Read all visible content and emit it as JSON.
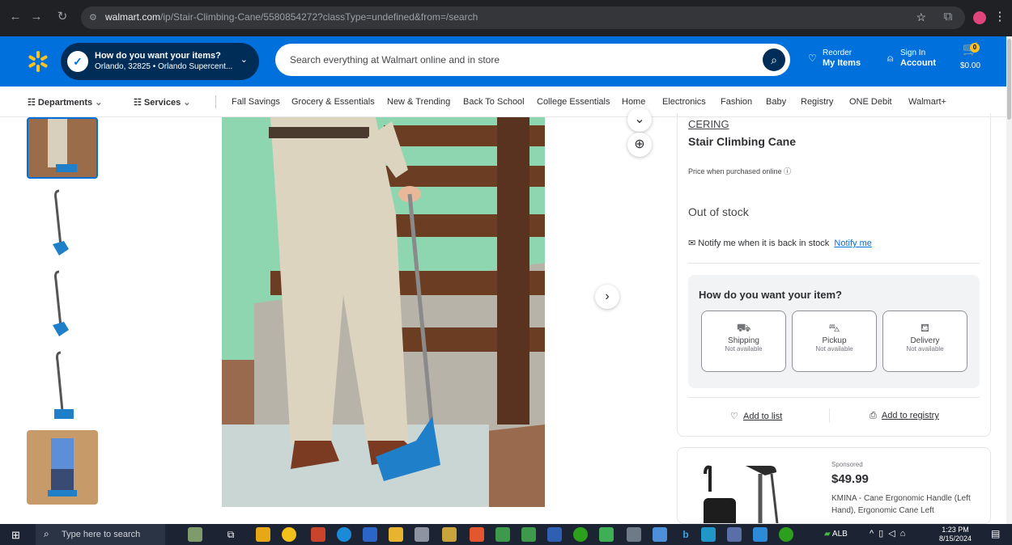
{
  "browser": {
    "url_domain": "walmart.com",
    "url_path": "/ip/Stair-Climbing-Cane/5580854272?classType=undefined&from=/search"
  },
  "header": {
    "location_title": "How do you want your items?",
    "location_sub": "Orlando, 32825 • Orlando Supercent...",
    "search_placeholder": "Search everything at Walmart online and in store",
    "reorder_top": "Reorder",
    "reorder_bottom": "My Items",
    "signin_top": "Sign In",
    "signin_bottom": "Account",
    "cart_count": "0",
    "cart_total": "$0.00"
  },
  "nav": {
    "departments": "Departments",
    "services": "Services",
    "links": [
      "Fall Savings",
      "Grocery & Essentials",
      "New & Trending",
      "Back To School",
      "College Essentials",
      "Home",
      "Electronics",
      "Fashion",
      "Baby",
      "Registry",
      "ONE Debit",
      "Walmart+"
    ]
  },
  "product": {
    "brand": "CERING",
    "title": "Stair Climbing Cane",
    "price_note": "Price when purchased online",
    "stock": "Out of stock",
    "notify_text": "Notify me when it is back in stock",
    "notify_link": "Notify me",
    "fulfillment_heading": "How do you want your item?",
    "options": [
      {
        "label": "Shipping",
        "status": "Not available"
      },
      {
        "label": "Pickup",
        "status": "Not available"
      },
      {
        "label": "Delivery",
        "status": "Not available"
      }
    ],
    "add_to_list": "Add to list",
    "add_to_registry": "Add to registry"
  },
  "sponsored": {
    "tag": "Sponsored",
    "price": "$49.99",
    "desc": "KMINA - Cane Ergonomic Handle (Left Hand), Ergonomic Cane Left"
  },
  "taskbar": {
    "search": "Type here to search",
    "time": "1:23 PM",
    "date": "8/15/2024",
    "lang": "ALB"
  },
  "colors": {
    "walmart_blue": "#0071dc",
    "walmart_navy": "#002d58",
    "spark_yellow": "#ffc220",
    "cane_blue": "#1f7fc9"
  }
}
